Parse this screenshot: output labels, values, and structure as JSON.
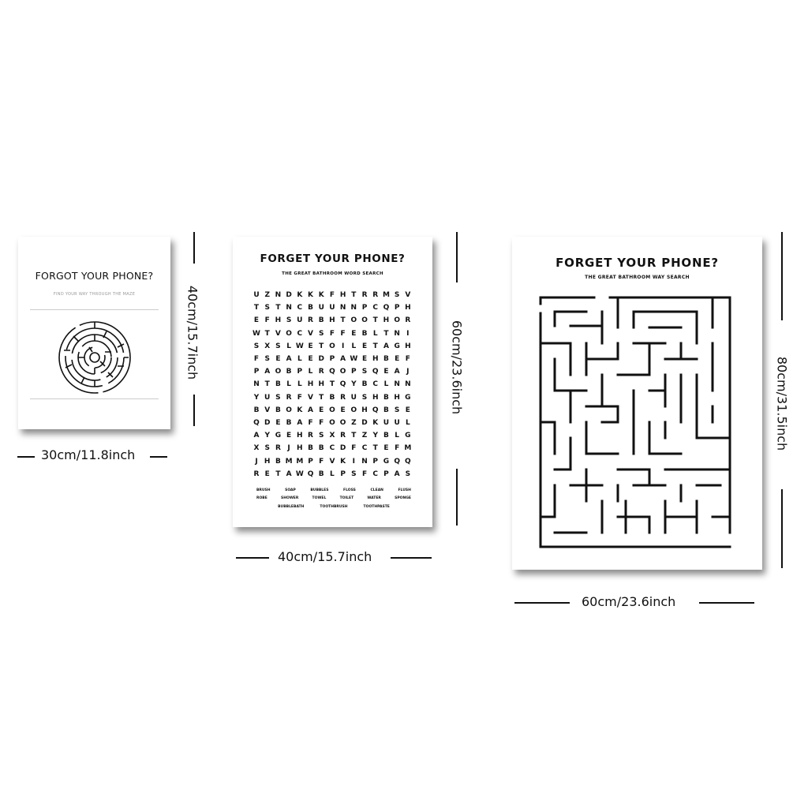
{
  "posters": [
    {
      "title": "FORGOT YOUR PHONE?",
      "subtitle": "FIND YOUR WAY THROUGH THE MAZE",
      "width_label": "30cm/11.8inch",
      "height_label": "40cm/15.7inch"
    },
    {
      "title": "FORGET YOUR PHONE?",
      "subtitle": "THE GREAT BATHROOM WORD SEARCH",
      "width_label": "40cm/15.7inch",
      "height_label": "60cm/23.6inch",
      "grid": [
        "UZNDKKKFHTRRMSV",
        "TSTNCBUUNNPCQPH",
        "EFHSURBHTOOTHOR",
        "WTVOCVSFFEBLTNI",
        "SXSLWETOILETAGH",
        "FSEALEDPAWEHBEF",
        "PAOBPLRQOPSQEAJ",
        "NTBLLHHTQYBCLNN",
        "YUSRFVTBRUSHBHG",
        "BVBOKAEOEOHQBSE",
        "QDEBAFFOOZDKUUL",
        "AYGEHRSXRTZYBLG",
        "XSRJHBBCDFCTEFM",
        "JHBMMPFVKINPGQQ",
        "RETAWQBLPSFCPAS"
      ],
      "words": [
        [
          "BRUSH",
          "SOAP",
          "BUBBLES",
          "FLOSS",
          "CLEAN",
          "FLUSH"
        ],
        [
          "ROBE",
          "SHOWER",
          "TOWEL",
          "TOILET",
          "WATER",
          "SPONGE"
        ],
        [
          "BUBBLEBATH",
          "TOOTHBRUSH",
          "TOOTHPASTE"
        ]
      ]
    },
    {
      "title": "FORGET YOUR PHONE?",
      "subtitle": "THE GREAT BATHROOM WAY SEARCH",
      "width_label": "60cm/23.6inch",
      "height_label": "80cm/31.5inch"
    }
  ]
}
